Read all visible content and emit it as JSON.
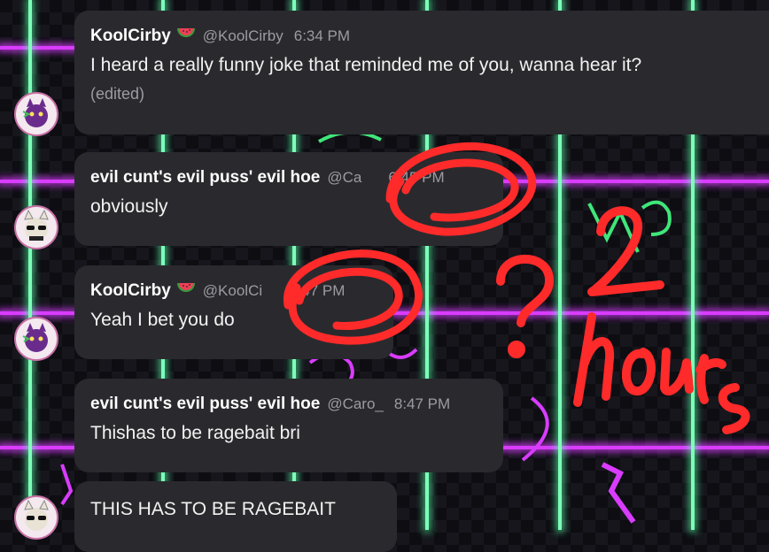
{
  "messages": [
    {
      "author": "KoolCirby",
      "emoji": "watermelon-icon",
      "handle": "@KoolCirby",
      "time": "6:34 PM",
      "text": "I heard a really funny joke that reminded me of you, wanna hear it?",
      "edited": "(edited)",
      "avatar": "purple-cat-avatar"
    },
    {
      "author": "evil cunt's evil puss' evil hoe",
      "handle": "@Caro_",
      "handle_visible": "@Ca",
      "time": "6:45 PM",
      "text": "obviously",
      "avatar": "sunglasses-cat-avatar"
    },
    {
      "author": "KoolCirby",
      "emoji": "watermelon-icon",
      "handle": "@KoolCirby",
      "handle_visible": "@KoolCi",
      "time": "8:47 PM",
      "text": "Yeah I bet you do",
      "avatar": "purple-cat-avatar"
    },
    {
      "author": "evil cunt's evil puss' evil hoe",
      "handle": "@Caro_",
      "time": "8:47 PM",
      "text": "Thishas to be ragebait bri",
      "avatar": "sunglasses-cat-avatar"
    },
    {
      "text": "THIS HAS TO BE RAGEBAIT",
      "avatar": "sunglasses-cat-avatar"
    }
  ],
  "annotation": {
    "color": "#ff2a2a",
    "handwritten_text": "2 hours",
    "question_mark": "?"
  },
  "theme": {
    "bubble": "#2a2a2e",
    "neon_pink": "#d93cff",
    "neon_green": "#7dffb8"
  }
}
